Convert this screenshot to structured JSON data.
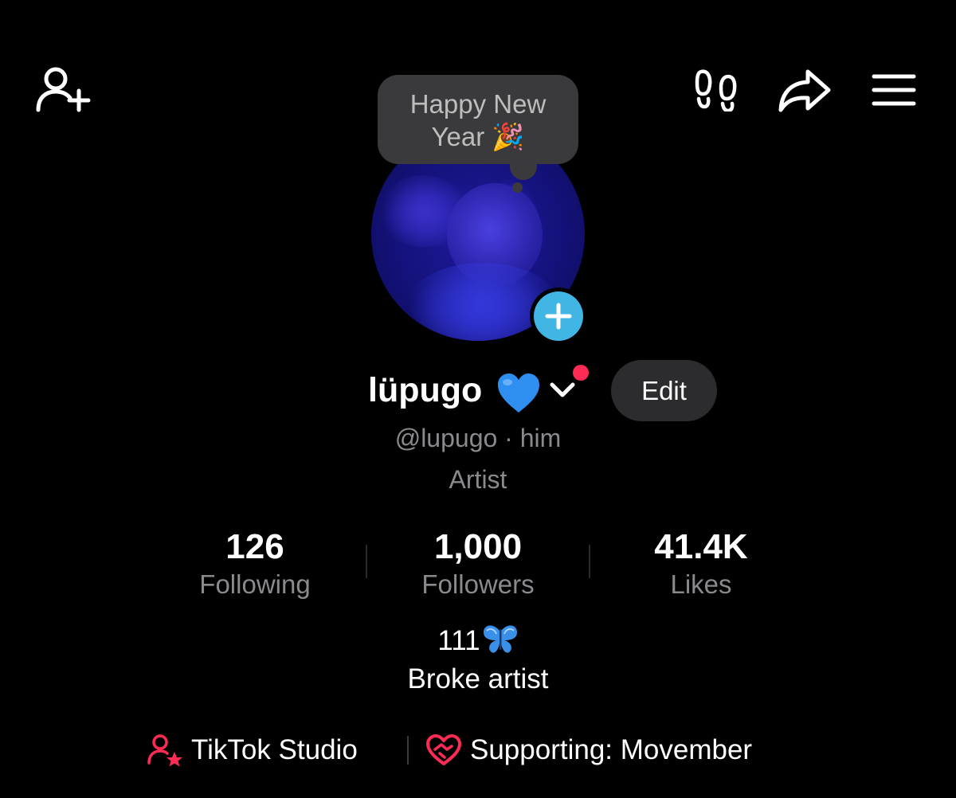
{
  "topbar": {
    "add_friends_icon": "person-plus-icon",
    "visitors_icon": "footprints-icon",
    "share_icon": "share-arrow-icon",
    "menu_icon": "hamburger-menu-icon"
  },
  "note": {
    "line1": "Happy New",
    "line2": "Year 🎉"
  },
  "profile": {
    "display_name": "lüpugo",
    "name_emoji": "blue-heart",
    "edit_label": "Edit",
    "handle": "@lupugo",
    "pronouns": "· him",
    "category": "Artist"
  },
  "stats": [
    {
      "value": "126",
      "label": "Following"
    },
    {
      "value": "1,000",
      "label": "Followers"
    },
    {
      "value": "41.4K",
      "label": "Likes"
    }
  ],
  "bio": {
    "line1": "111",
    "line1_emoji": "butterfly",
    "line2": "Broke artist"
  },
  "links": {
    "studio_label": "TikTok Studio",
    "supporting_label": "Supporting: Movember"
  },
  "colors": {
    "background": "#000000",
    "accent_red": "#fe2c55",
    "badge_blue": "#41b5e3",
    "muted_text": "#8a8a8e",
    "pill_bg": "#2c2c2e"
  }
}
